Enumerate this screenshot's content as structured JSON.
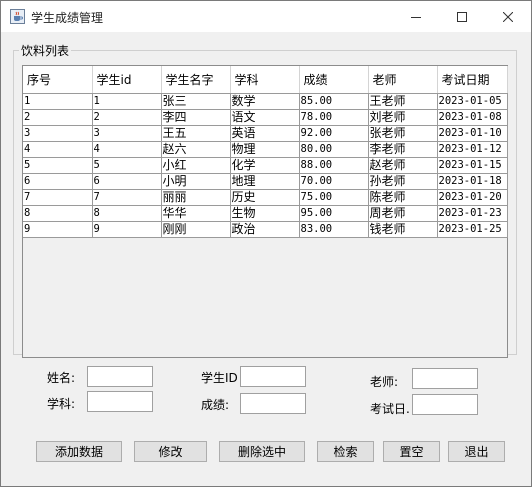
{
  "window": {
    "title": "学生成绩管理",
    "controls": {
      "minimize": "—",
      "maximize": "☐",
      "close": "✕"
    }
  },
  "group": {
    "legend": "饮料列表"
  },
  "table": {
    "columns": [
      "序号",
      "学生id",
      "学生名字",
      "学科",
      "成绩",
      "老师",
      "考试日期"
    ],
    "rows": [
      [
        "1",
        "1",
        "张三",
        "数学",
        "85.00",
        "王老师",
        "2023-01-05"
      ],
      [
        "2",
        "2",
        "李四",
        "语文",
        "78.00",
        "刘老师",
        "2023-01-08"
      ],
      [
        "3",
        "3",
        "王五",
        "英语",
        "92.00",
        "张老师",
        "2023-01-10"
      ],
      [
        "4",
        "4",
        "赵六",
        "物理",
        "80.00",
        "李老师",
        "2023-01-12"
      ],
      [
        "5",
        "5",
        "小红",
        "化学",
        "88.00",
        "赵老师",
        "2023-01-15"
      ],
      [
        "6",
        "6",
        "小明",
        "地理",
        "70.00",
        "孙老师",
        "2023-01-18"
      ],
      [
        "7",
        "7",
        "丽丽",
        "历史",
        "75.00",
        "陈老师",
        "2023-01-20"
      ],
      [
        "8",
        "8",
        "华华",
        "生物",
        "95.00",
        "周老师",
        "2023-01-23"
      ],
      [
        "9",
        "9",
        "刚刚",
        "政治",
        "83.00",
        "钱老师",
        "2023-01-25"
      ]
    ]
  },
  "form": {
    "name_label": "姓名:",
    "student_id_label": "学生ID",
    "teacher_label": "老师:",
    "subject_label": "学科:",
    "score_label": "成绩:",
    "exam_date_label": "考试日.",
    "name_value": "",
    "student_id_value": "",
    "teacher_value": "",
    "subject_value": "",
    "score_value": "",
    "exam_date_value": ""
  },
  "buttons": {
    "add": "添加数据",
    "edit": "修改",
    "delete": "删除选中",
    "search": "检索",
    "clear": "置空",
    "exit": "退出"
  },
  "colors": {
    "window_bg": "#f0f0f0",
    "titlebar_bg": "#ffffff",
    "grid_line": "#9a9a9a",
    "button_bg": "#e1e1e1"
  }
}
